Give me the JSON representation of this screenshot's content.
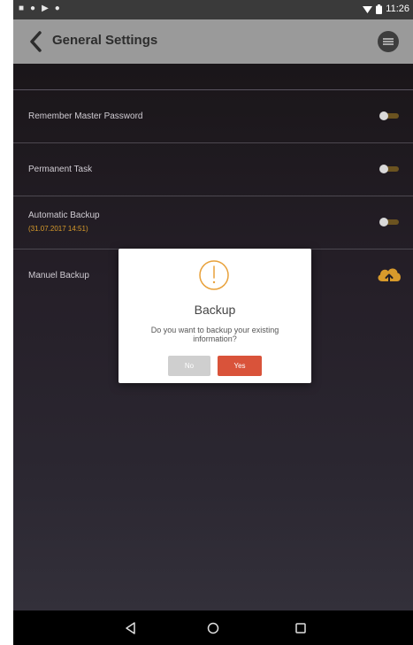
{
  "status_bar": {
    "left_icons": [
      "notification-icon",
      "notification-icon",
      "play-store-icon",
      "notification-icon"
    ],
    "time": "11:26"
  },
  "app_bar": {
    "title": "General Settings"
  },
  "settings": [
    {
      "label": "Remember Master Password",
      "control": "toggle",
      "on": false
    },
    {
      "label": "Permanent Task",
      "control": "toggle",
      "on": false
    },
    {
      "label": "Automatic Backup",
      "sublabel": "(31.07.2017 14:51)",
      "control": "toggle",
      "on": false
    },
    {
      "label": "Manuel Backup",
      "control": "cloud-upload-icon"
    }
  ],
  "dialog": {
    "title": "Backup",
    "message": "Do you want to backup your existing information?",
    "no_label": "No",
    "yes_label": "Yes"
  },
  "colors": {
    "app_bar": "#9a9a9a",
    "background": "#231f26",
    "accent": "#d79a2b",
    "yes_button": "#d9533a",
    "no_button": "#cfcfcf"
  }
}
